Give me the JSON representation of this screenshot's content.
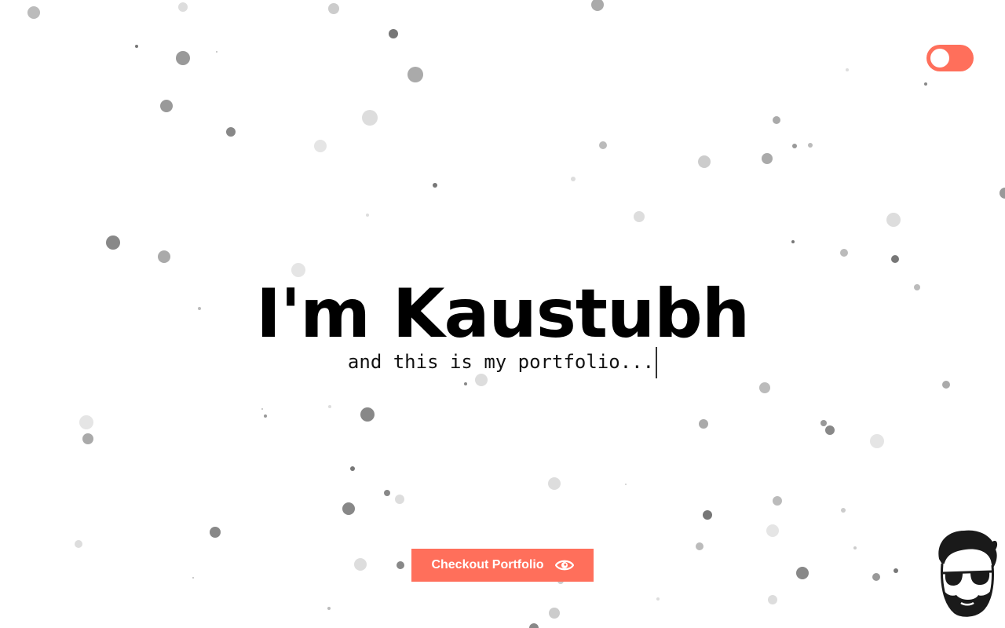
{
  "hero": {
    "title": "I'm Kaustubh",
    "subtitle": "and this is my portfolio..."
  },
  "cta": {
    "label": "Checkout Portfolio",
    "icon": "eye-icon"
  },
  "theme_toggle": {
    "state": "off"
  },
  "avatar": {
    "icon": "avatar-sunglasses-icon"
  },
  "colors": {
    "accent": "#ff6f5b",
    "background": "#ffffff",
    "text": "#000000"
  }
}
